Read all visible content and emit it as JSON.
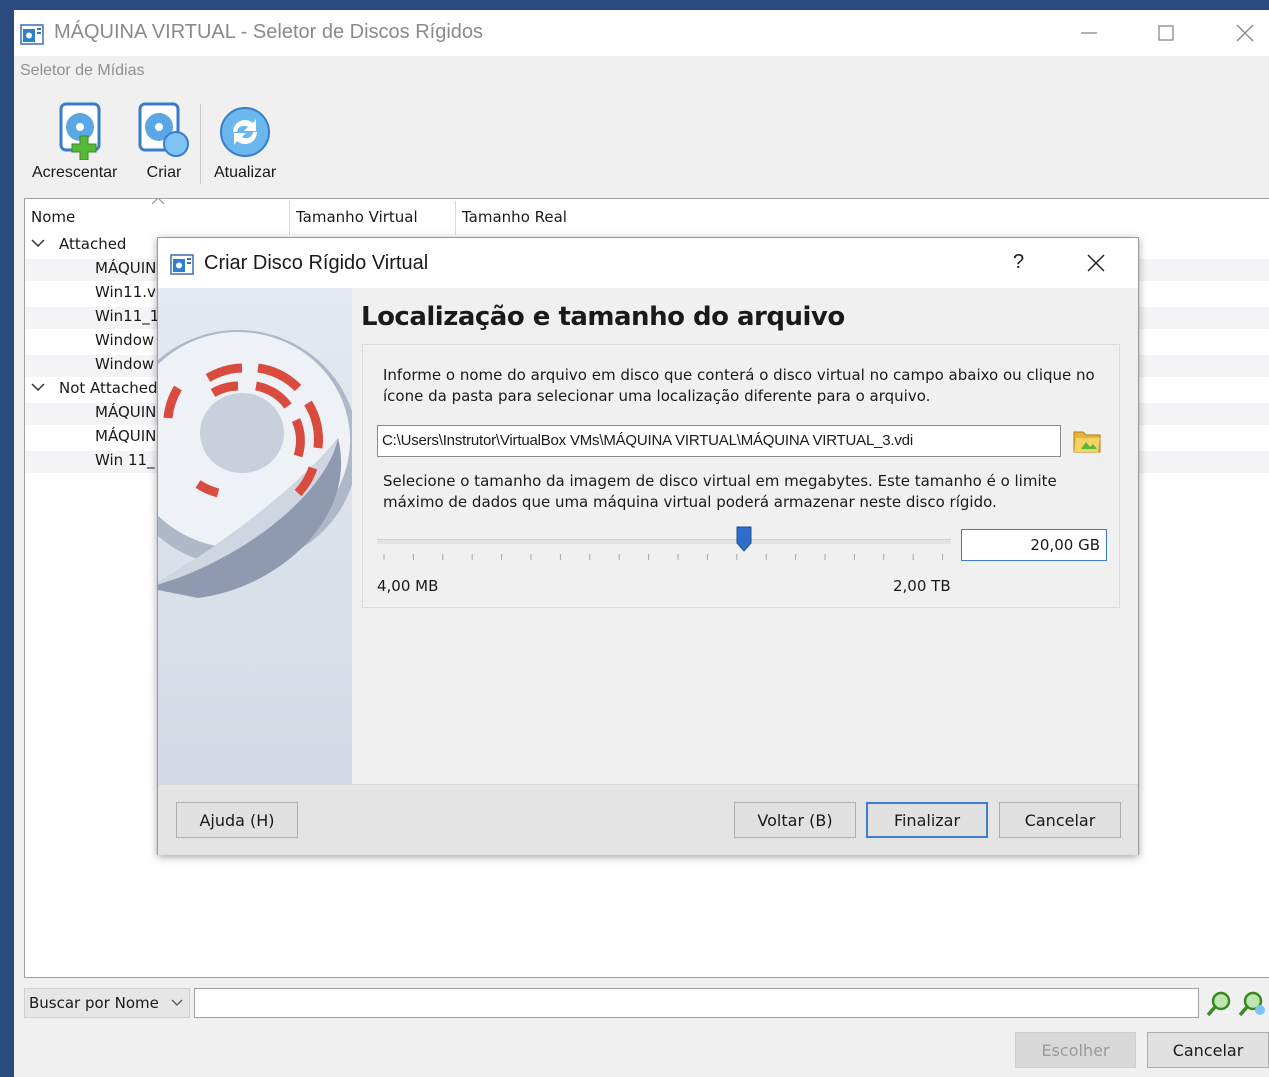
{
  "window": {
    "title": "MÁQUINA VIRTUAL - Seletor de Discos Rígidos",
    "subtitle": "Seletor de Mídias"
  },
  "toolbar": {
    "add_label": "Acrescentar",
    "create_label": "Criar",
    "refresh_label": "Atualizar"
  },
  "table": {
    "columns": [
      "Nome",
      "Tamanho Virtual",
      "Tamanho Real"
    ],
    "groups": [
      {
        "label": "Attached",
        "items": [
          "MÁQUIN",
          "Win11.v",
          "Win11_1",
          "Window",
          "Window"
        ]
      },
      {
        "label": "Not Attached",
        "items": [
          "MÁQUIN",
          "MÁQUIN",
          "Win 11_"
        ]
      }
    ]
  },
  "search": {
    "mode": "Buscar por Nome",
    "value": ""
  },
  "bottom_buttons": {
    "choose": "Escolher",
    "cancel": "Cancelar"
  },
  "dialog": {
    "title": "Criar Disco Rígido Virtual",
    "help_glyph": "?",
    "heading": "Localização e tamanho do arquivo",
    "location_text_1": "Informe o nome do arquivo em disco que conterá o disco virtual no campo abaixo ou clique no",
    "location_text_2": "ícone da pasta para selecionar uma localização diferente para o arquivo.",
    "file_path": "C:\\Users\\Instrutor\\VirtualBox VMs\\MÁQUINA VIRTUAL\\MÁQUINA VIRTUAL_3.vdi",
    "size_text_1": "Selecione o tamanho da imagem de disco virtual em megabytes. Este tamanho é o limite",
    "size_text_2": "máximo de dados que uma máquina virtual poderá armazenar neste disco rígido.",
    "size_value": "20,00 GB",
    "size_min": "4,00 MB",
    "size_max": "2,00 TB",
    "buttons": {
      "help": "Ajuda (H)",
      "back": "Voltar (B)",
      "finish": "Finalizar",
      "cancel": "Cancelar"
    }
  },
  "colors": {
    "desktop": "#2b4a7e",
    "accent": "#3e7cd2",
    "disk_red": "#d94b3f"
  }
}
